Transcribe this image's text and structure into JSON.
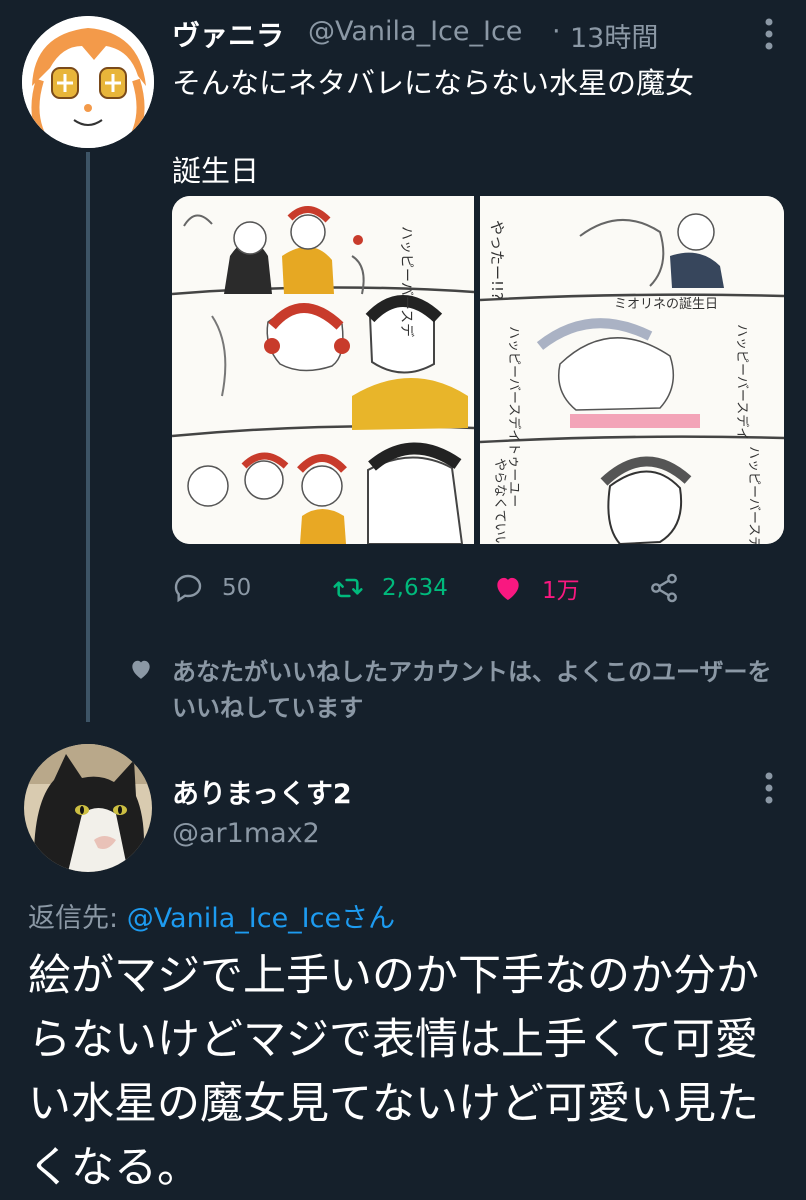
{
  "tweet1": {
    "display_name": "ヴァニラ",
    "handle": "@Vanila_Ice_Ice",
    "separator": "·",
    "time": "13時間",
    "text_line1": "そんなにネタバレにならない水星の魔女",
    "text_line2": "誕生日",
    "more_icon": "more-vertical-icon",
    "actions": {
      "reply": {
        "icon": "reply-icon",
        "count": "50",
        "color": "#8b98a5"
      },
      "retweet": {
        "icon": "retweet-icon",
        "count": "2,634",
        "color": "#00ba7c"
      },
      "like": {
        "icon": "heart-icon",
        "count": "1万",
        "color": "#f91880"
      },
      "share": {
        "icon": "share-icon"
      }
    },
    "media": {
      "left_panel_labels": [
        "ハッピーバースデー"
      ],
      "right_panel_labels": [
        "やったー!!?",
        "ミオリネの誕生日",
        "ハッピーバースデートゥーユー",
        "ハッピーバースデーディアー",
        "やらなくていいのよそれ"
      ]
    }
  },
  "social_context": {
    "icon": "heart-icon",
    "text": "あなたがいいねしたアカウントは、よくこのユーザーをいいねしています"
  },
  "tweet2": {
    "display_name": "ありまっくす2",
    "handle": "@ar1max2",
    "reply_prefix": "返信先: ",
    "reply_target": "@Vanila_Ice_Iceさん",
    "text": "絵がマジで上手いのか下手なのか分からないけどマジで表情は上手くて可愛い水星の魔女見てないけど可愛い見たくなる。",
    "more_icon": "more-vertical-icon"
  },
  "colors": {
    "background": "#15202b",
    "secondary_text": "#8b98a5",
    "link": "#1d9bf0",
    "retweet_green": "#00ba7c",
    "like_pink": "#f91880",
    "thread_line": "#3d5466"
  }
}
